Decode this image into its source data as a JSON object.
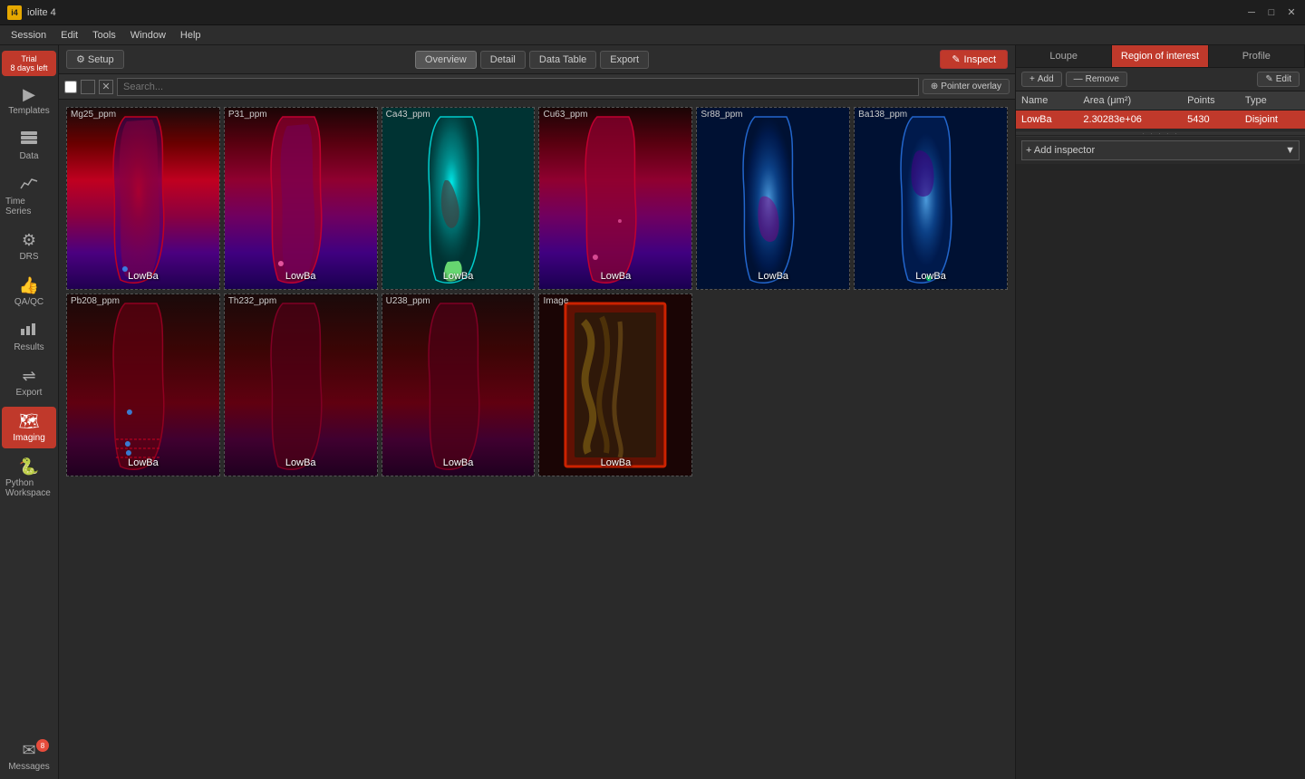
{
  "app": {
    "title": "iolite 4",
    "icon": "i4"
  },
  "titlebar": {
    "minimize": "─",
    "maximize": "□",
    "close": "✕"
  },
  "menubar": {
    "items": [
      "Session",
      "Edit",
      "Tools",
      "Window",
      "Help"
    ]
  },
  "sidebar": {
    "trial_label": "Trial",
    "trial_days": "8 days left",
    "items": [
      {
        "id": "templates",
        "label": "Templates",
        "icon": "▶"
      },
      {
        "id": "data",
        "label": "Data",
        "icon": "🗄"
      },
      {
        "id": "timeseries",
        "label": "Time Series",
        "icon": "📈"
      },
      {
        "id": "drs",
        "label": "DRS",
        "icon": "⚙"
      },
      {
        "id": "qaqc",
        "label": "QA/QC",
        "icon": "👍"
      },
      {
        "id": "results",
        "label": "Results",
        "icon": "📊"
      },
      {
        "id": "export",
        "label": "Export",
        "icon": "⇌"
      },
      {
        "id": "imaging",
        "label": "Imaging",
        "icon": "🗺"
      },
      {
        "id": "python",
        "label": "Python Workspace",
        "icon": "🐍"
      }
    ],
    "messages": {
      "label": "Messages",
      "badge": "8"
    }
  },
  "toolbar": {
    "setup_label": "⚙ Setup",
    "tabs": [
      "Overview",
      "Detail",
      "Data Table",
      "Export"
    ],
    "active_tab": "Overview",
    "inspect_label": "Inspect"
  },
  "image_toolbar": {
    "search_placeholder": "Search...",
    "pointer_overlay_label": "Pointer overlay"
  },
  "channels": [
    {
      "id": "Mg25_ppm",
      "label": "Mg25_ppm",
      "colormap": "cm-Mg25",
      "roi": "LowBa"
    },
    {
      "id": "P31_ppm",
      "label": "P31_ppm",
      "colormap": "cm-P31",
      "roi": "LowBa"
    },
    {
      "id": "Ca43_ppm",
      "label": "Ca43_ppm",
      "colormap": "cm-Ca43",
      "roi": "LowBa"
    },
    {
      "id": "Cu63_ppm",
      "label": "Cu63_ppm",
      "colormap": "cm-Cu63",
      "roi": "LowBa"
    },
    {
      "id": "Sr88_ppm",
      "label": "Sr88_ppm",
      "colormap": "cm-Sr88",
      "roi": "LowBa"
    },
    {
      "id": "Ba138_ppm",
      "label": "Ba138_ppm",
      "colormap": "cm-Ba138",
      "roi": "LowBa"
    },
    {
      "id": "Pb208_ppm",
      "label": "Pb208_ppm",
      "colormap": "cm-Pb208",
      "roi": "LowBa"
    },
    {
      "id": "Th232_ppm",
      "label": "Th232_ppm",
      "colormap": "cm-Th232",
      "roi": "LowBa"
    },
    {
      "id": "U238_ppm",
      "label": "U238_ppm",
      "colormap": "cm-U238",
      "roi": "LowBa"
    },
    {
      "id": "Image",
      "label": "Image",
      "colormap": "cm-photo",
      "roi": "LowBa"
    }
  ],
  "right_panel": {
    "tabs": [
      "Loupe",
      "Region of interest",
      "Profile"
    ],
    "active_tab": "Region of interest",
    "roi_toolbar": {
      "add_label": "+ Add",
      "remove_label": "— Remove",
      "edit_label": "✎ Edit"
    },
    "roi_table": {
      "headers": [
        "Name",
        "Area (μm²)",
        "Points",
        "Type"
      ],
      "rows": [
        {
          "name": "LowBa",
          "area": "2.30283e+06",
          "points": "5430",
          "type": "Disjoint",
          "selected": true
        }
      ]
    },
    "add_inspector": {
      "label": "+ Add inspector"
    }
  }
}
